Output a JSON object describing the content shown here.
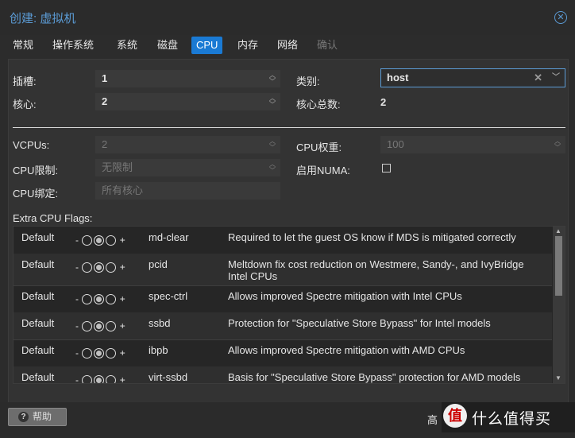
{
  "window": {
    "title": "创建: 虚拟机"
  },
  "tabs": [
    {
      "label": "常规"
    },
    {
      "label": "操作系统"
    },
    {
      "label": "系统"
    },
    {
      "label": "磁盘"
    },
    {
      "label": "CPU"
    },
    {
      "label": "内存"
    },
    {
      "label": "网络"
    },
    {
      "label": "确认"
    }
  ],
  "active_tab": "CPU",
  "form": {
    "sockets_label": "插槽:",
    "sockets_value": "1",
    "cores_label": "核心:",
    "cores_value": "2",
    "type_label": "类别:",
    "type_value": "host",
    "total_cores_label": "核心总数:",
    "total_cores_value": "2",
    "vcpus_label": "VCPUs:",
    "vcpus_value": "2",
    "cpu_limit_label": "CPU限制:",
    "cpu_limit_placeholder": "无限制",
    "cpu_affinity_label": "CPU绑定:",
    "cpu_affinity_placeholder": "所有核心",
    "cpu_weight_label": "CPU权重:",
    "cpu_weight_placeholder": "100",
    "numa_label": "启用NUMA:",
    "numa_checked": false
  },
  "flags": {
    "title": "Extra CPU Flags:",
    "rows": [
      {
        "state": "Default",
        "minus": "-",
        "plus": "+",
        "name": "md-clear",
        "desc": "Required to let the guest OS know if MDS is mitigated correctly"
      },
      {
        "state": "Default",
        "minus": "-",
        "plus": "+",
        "name": "pcid",
        "desc": "Meltdown fix cost reduction on Westmere, Sandy-, and IvyBridge Intel CPUs"
      },
      {
        "state": "Default",
        "minus": "-",
        "plus": "+",
        "name": "spec-ctrl",
        "desc": "Allows improved Spectre mitigation with Intel CPUs"
      },
      {
        "state": "Default",
        "minus": "-",
        "plus": "+",
        "name": "ssbd",
        "desc": "Protection for \"Speculative Store Bypass\" for Intel models"
      },
      {
        "state": "Default",
        "minus": "-",
        "plus": "+",
        "name": "ibpb",
        "desc": "Allows improved Spectre mitigation with AMD CPUs"
      },
      {
        "state": "Default",
        "minus": "-",
        "plus": "+",
        "name": "virt-ssbd",
        "desc": "Basis for \"Speculative Store Bypass\" protection for AMD models"
      }
    ]
  },
  "footer": {
    "help_label": "帮助",
    "advanced_label": "高",
    "watermark_logo": "值",
    "watermark_text": "什么值得买"
  },
  "colors": {
    "accent": "#1a7ad4",
    "title": "#5b9bd5"
  }
}
